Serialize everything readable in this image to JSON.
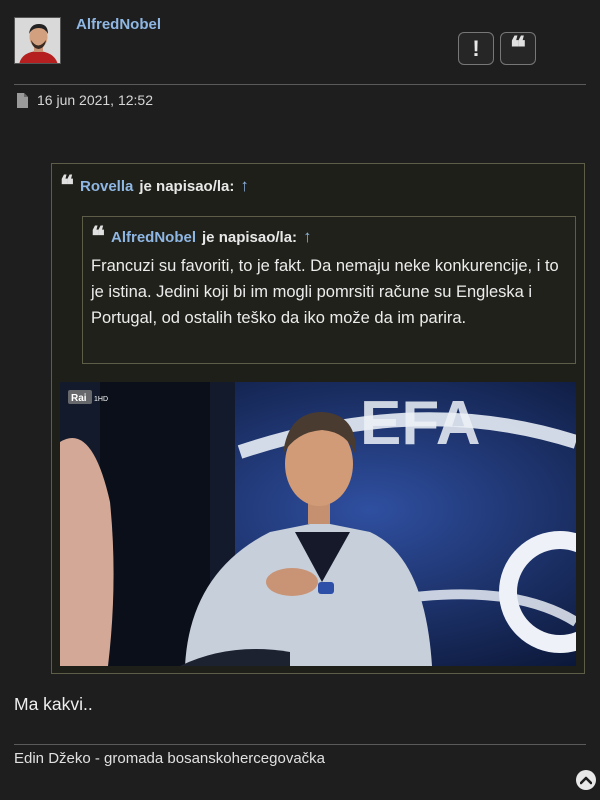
{
  "post": {
    "username": "AlfredNobel",
    "date": "16 jun 2021, 12:52",
    "actions": [
      {
        "icon": "exclamation-icon",
        "glyph": "!"
      },
      {
        "icon": "quote-icon",
        "glyph": "❝"
      }
    ],
    "body_text": "Ma kakvi..",
    "signature": "Edin Džeko - gromada bosanskohercegovačka"
  },
  "quote_outer": {
    "author": "Rovella",
    "wrote_label": "je napisao/la:",
    "arrow": "↑",
    "image_badge": "Rai",
    "image_badge_suffix": "1HD",
    "image_background_letters": "EFA"
  },
  "quote_inner": {
    "author": "AlfredNobel",
    "wrote_label": "je napisao/la:",
    "arrow": "↑",
    "text": "Francuzi su favoriti, to je fakt. Da nemaju neke konkurencije, i to je istina. Jedini koji bi im mogli pomrsiti račune su Engleska i Portugal, od ostalih teško da iko može da im parira."
  },
  "colors": {
    "background": "#1e1e1f",
    "link": "#8fb7e3",
    "quote_border": "#5d5d48"
  }
}
